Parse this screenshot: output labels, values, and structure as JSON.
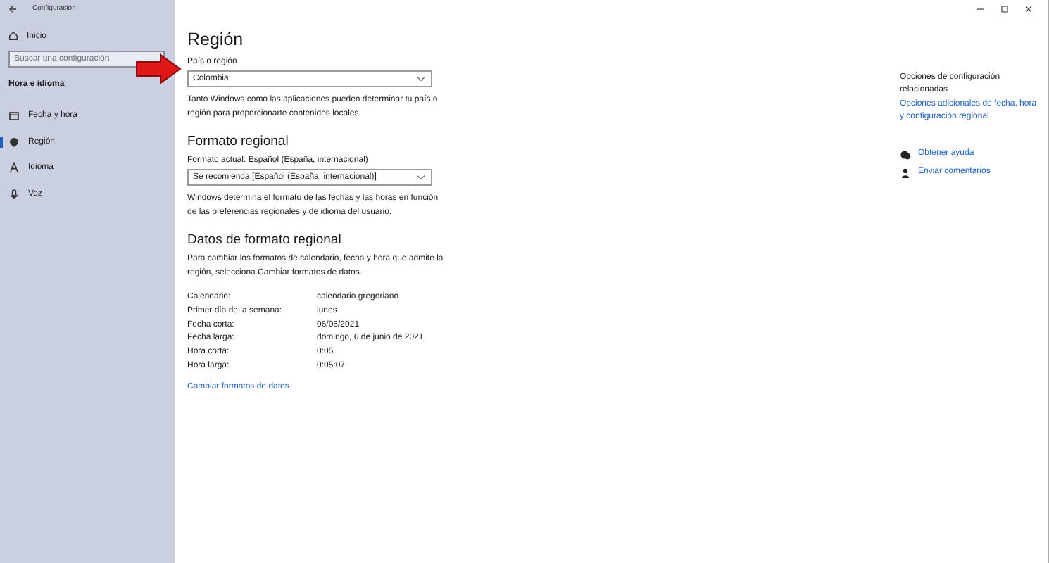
{
  "window": {
    "title": "Configuración"
  },
  "sidebar": {
    "home": "Inicio",
    "search": {
      "placeholder": "Buscar una configuración"
    },
    "section": "Hora e idioma",
    "items": [
      {
        "label": "Fecha y hora",
        "kind": "calendar",
        "selected": false
      },
      {
        "label": "Región",
        "kind": "region",
        "selected": true
      },
      {
        "label": "Idioma",
        "kind": "language",
        "selected": false
      },
      {
        "label": "Voz",
        "kind": "mic",
        "selected": false
      }
    ]
  },
  "main": {
    "title": "Región",
    "country": {
      "label": "País o región",
      "value": "Colombia"
    },
    "country_note": "Tanto Windows como las aplicaciones pueden determinar tu país o región para proporcionarte contenidos locales.",
    "format_heading": "Formato regional",
    "format": {
      "label": "Formato actual: Español (España, internacional)",
      "value": "Se recomienda [Español (España, internacional)]"
    },
    "format_note": "Windows determina el formato de las fechas y las horas en función de las preferencias regionales y de idioma del usuario.",
    "data_heading": "Datos de formato regional",
    "data_note": "Para cambiar los formatos de calendario, fecha y hora que admite la región, selecciona Cambiar formatos de datos.",
    "rows": [
      {
        "label": "Calendario:",
        "value": "calendario gregoriano"
      },
      {
        "label": "Primer día de la semana:",
        "value": "lunes"
      },
      {
        "label": "Fecha corta:",
        "value": "06/06/2021"
      },
      {
        "label": "Fecha larga:",
        "value": "domingo, 6 de junio de 2021"
      },
      {
        "label": "Hora corta:",
        "value": "0:05"
      },
      {
        "label": "Hora larga:",
        "value": "0:05:07"
      }
    ],
    "change_link": "Cambiar formatos de datos"
  },
  "related": {
    "heading": "Opciones de configuración relacionadas",
    "link": "Opciones adicionales de fecha, hora y configuración regional",
    "help": [
      {
        "kind": "help",
        "label": "Obtener ayuda"
      },
      {
        "kind": "feedback",
        "label": "Enviar comentarios"
      }
    ]
  }
}
